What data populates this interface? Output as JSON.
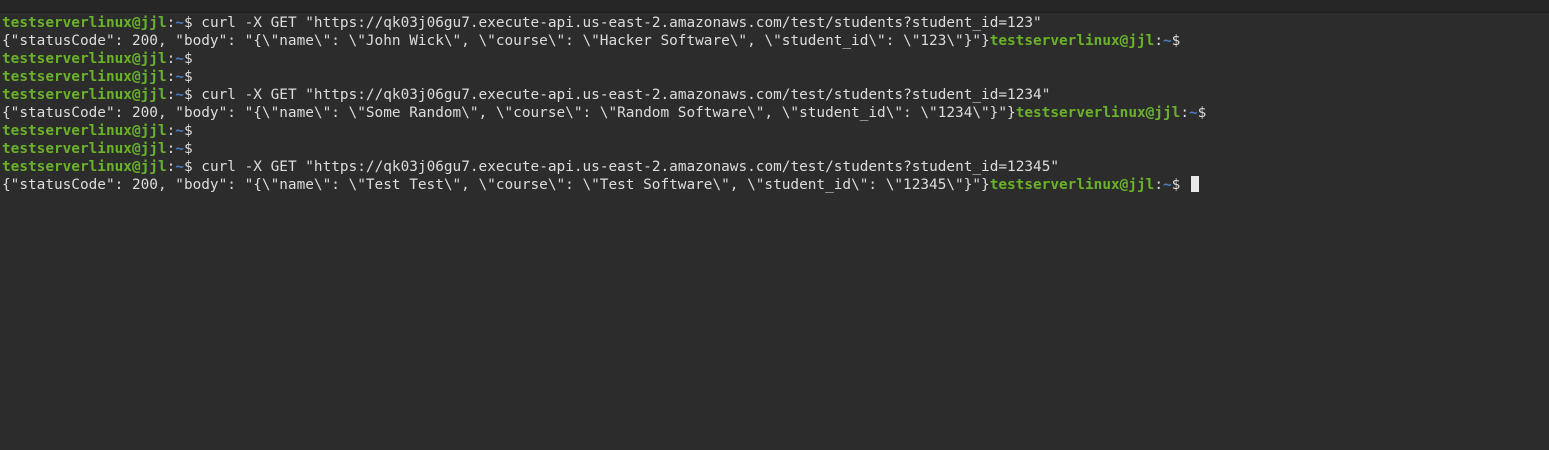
{
  "prompt": {
    "user_host": "testserverlinux@jjl",
    "separator": ":",
    "path": "~",
    "symbol": "$"
  },
  "lines": [
    {
      "kind": "prompt",
      "command": " curl -X GET \"https://qk03j06gu7.execute-api.us-east-2.amazonaws.com/test/students?student_id=123\""
    },
    {
      "kind": "output",
      "text": "{\"statusCode\": 200, \"body\": \"{\\\"name\\\": \\\"John Wick\\\", \\\"course\\\": \\\"Hacker Software\\\", \\\"student_id\\\": \\\"123\\\"}\"}"
    },
    {
      "kind": "prompt",
      "command": ""
    },
    {
      "kind": "prompt",
      "command": ""
    },
    {
      "kind": "prompt",
      "command": " curl -X GET \"https://qk03j06gu7.execute-api.us-east-2.amazonaws.com/test/students?student_id=1234\""
    },
    {
      "kind": "output",
      "text": "{\"statusCode\": 200, \"body\": \"{\\\"name\\\": \\\"Some Random\\\", \\\"course\\\": \\\"Random Software\\\", \\\"student_id\\\": \\\"1234\\\"}\"}"
    },
    {
      "kind": "prompt",
      "command": ""
    },
    {
      "kind": "prompt",
      "command": ""
    },
    {
      "kind": "prompt",
      "command": " curl -X GET \"https://qk03j06gu7.execute-api.us-east-2.amazonaws.com/test/students?student_id=12345\""
    },
    {
      "kind": "output",
      "text": "{\"statusCode\": 200, \"body\": \"{\\\"name\\\": \\\"Test Test\\\", \\\"course\\\": \\\"Test Software\\\", \\\"student_id\\\": \\\"12345\\\"}\"}",
      "cursor": true
    }
  ],
  "colors": {
    "background": "#2c2c2c",
    "user_host": "#6ab22a",
    "path": "#4a7bc4",
    "text": "#dcdcdc"
  }
}
